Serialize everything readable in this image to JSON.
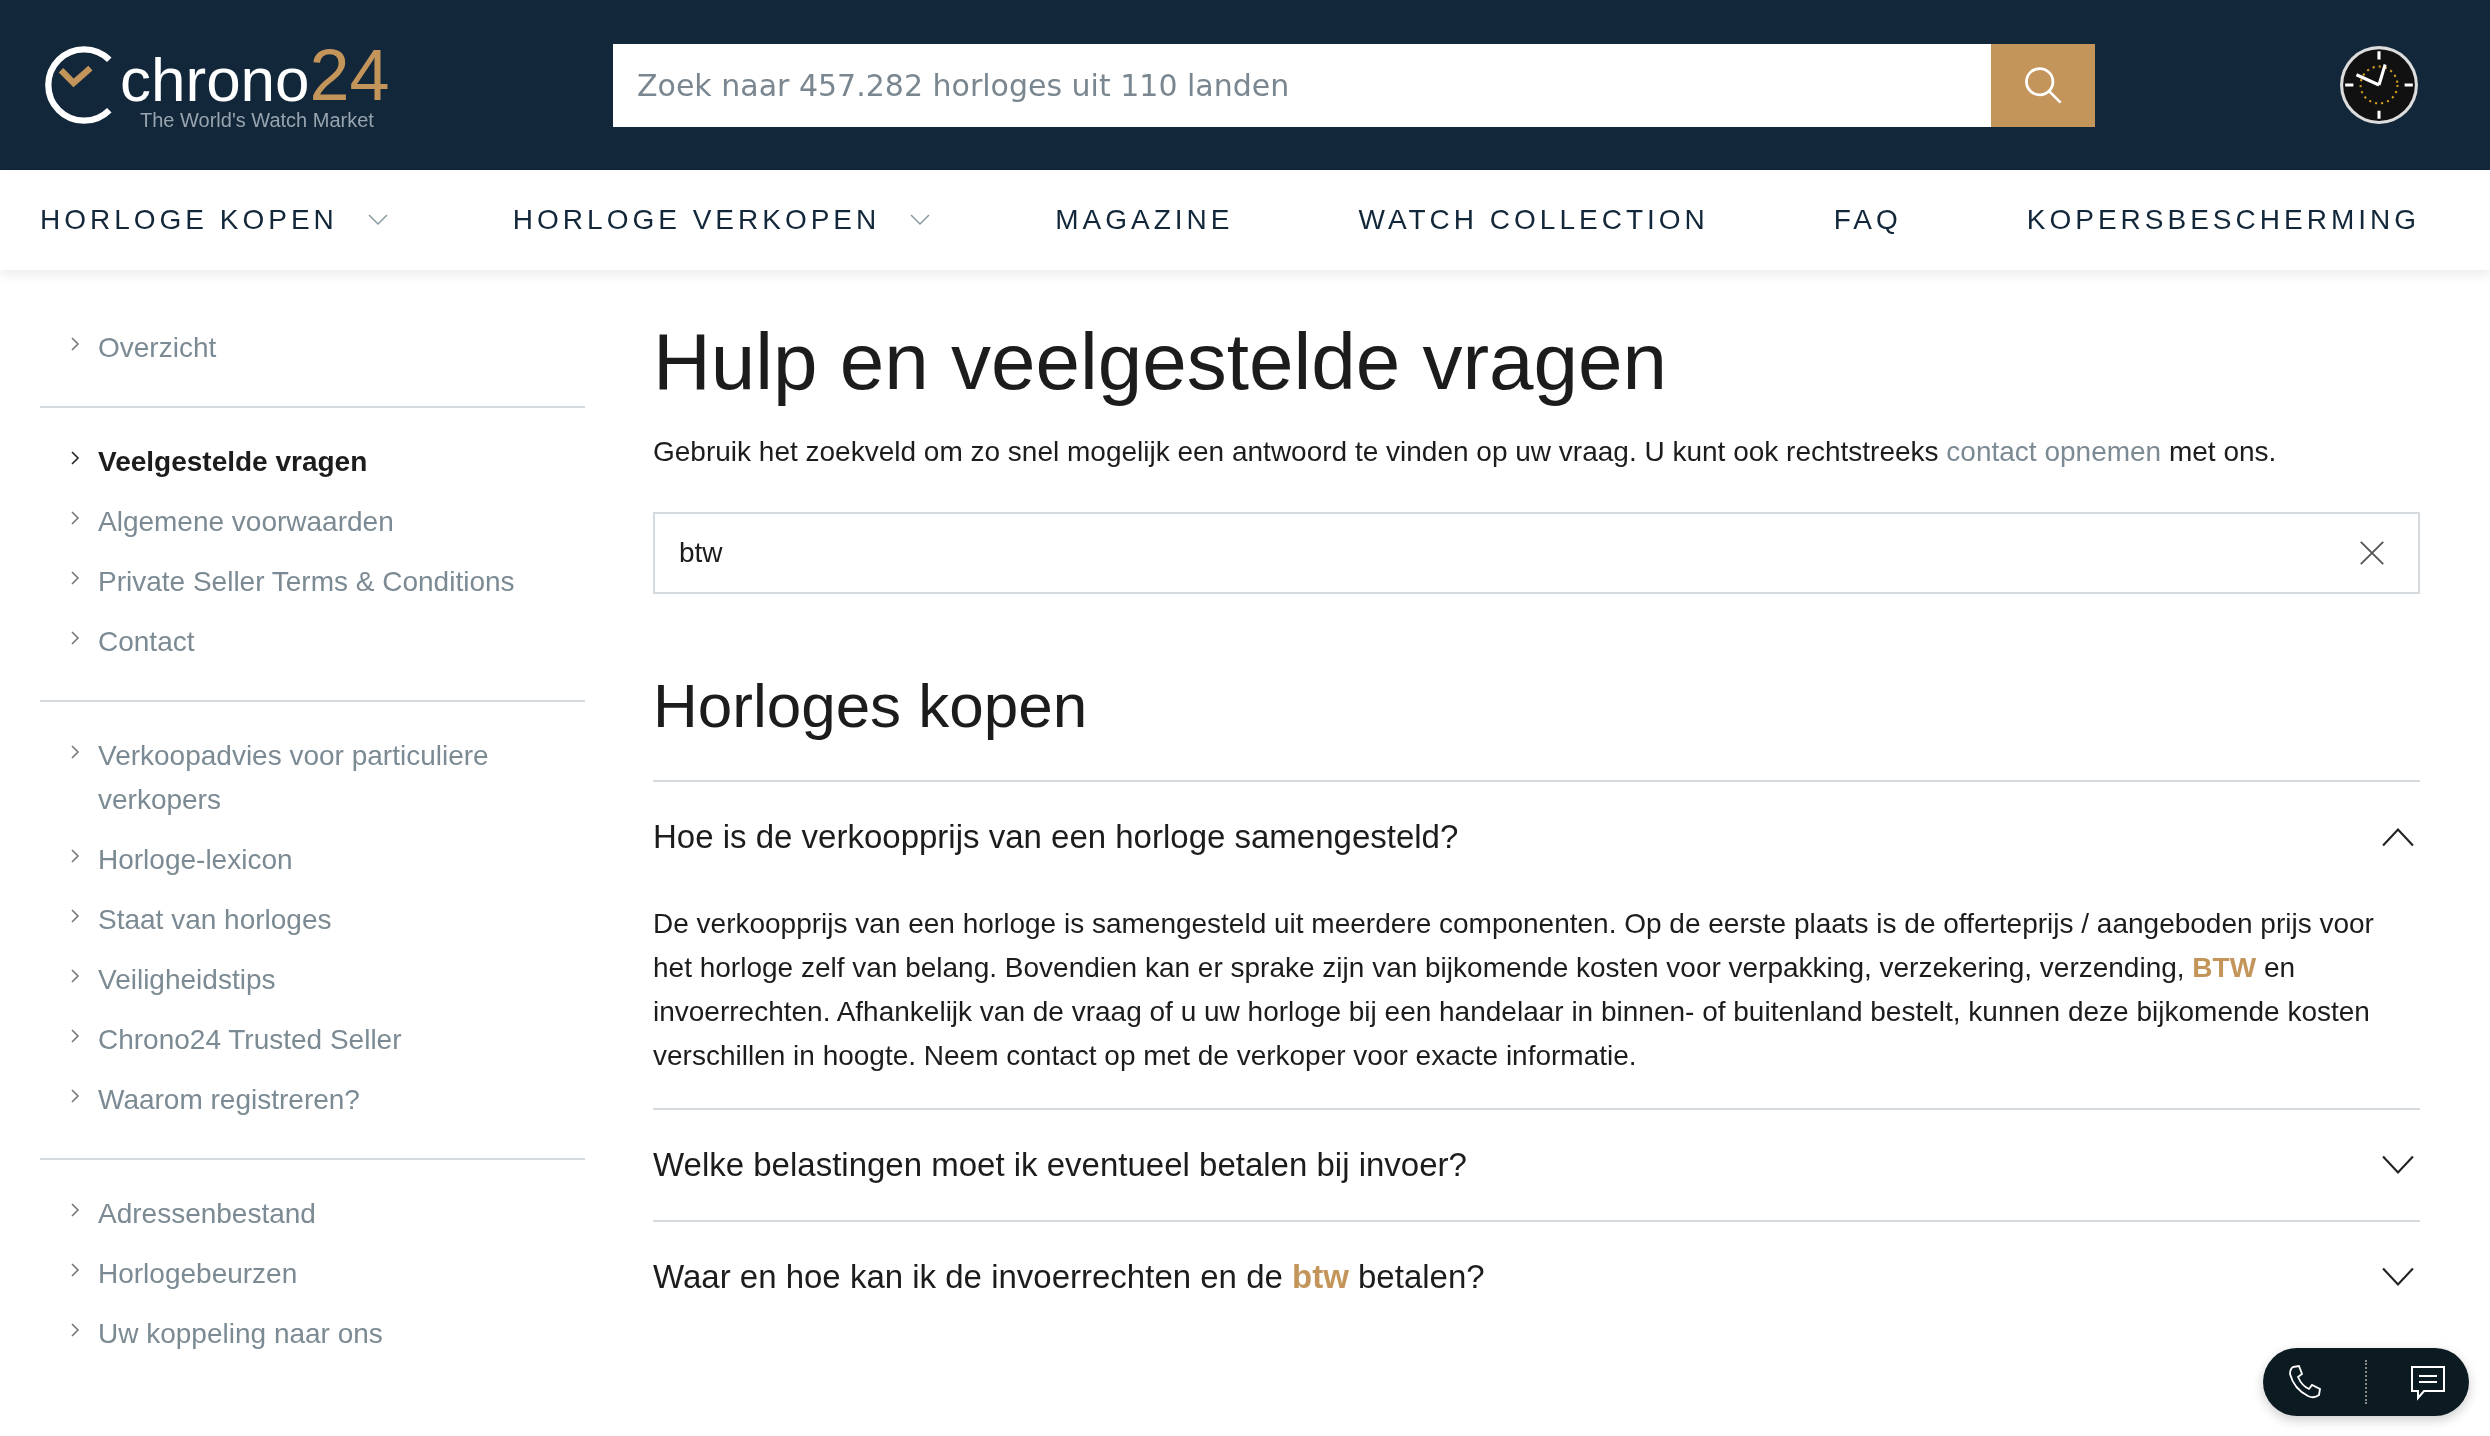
{
  "header": {
    "logo": {
      "word": "chrono",
      "number": "24",
      "tagline": "The World's Watch Market"
    },
    "search": {
      "placeholder": "Zoek naar 457.282 horloges uit 110 landen"
    }
  },
  "nav": [
    {
      "label": "HORLOGE KOPEN",
      "has_dropdown": true
    },
    {
      "label": "HORLOGE VERKOPEN",
      "has_dropdown": true
    },
    {
      "label": "MAGAZINE",
      "has_dropdown": false
    },
    {
      "label": "WATCH COLLECTION",
      "has_dropdown": false
    },
    {
      "label": "FAQ",
      "has_dropdown": false
    },
    {
      "label": "KOPERSBESCHERMING",
      "has_dropdown": false
    }
  ],
  "sidebar": {
    "groups": [
      [
        {
          "label": "Overzicht",
          "selected": false
        }
      ],
      [
        {
          "label": "Veelgestelde vragen",
          "selected": true
        },
        {
          "label": "Algemene voorwaarden",
          "selected": false
        },
        {
          "label": "Private Seller Terms & Conditions",
          "selected": false
        },
        {
          "label": "Contact",
          "selected": false
        }
      ],
      [
        {
          "label": "Verkoopadvies voor particuliere verkopers",
          "selected": false
        },
        {
          "label": "Horloge-lexicon",
          "selected": false
        },
        {
          "label": "Staat van horloges",
          "selected": false
        },
        {
          "label": "Veiligheidstips",
          "selected": false
        },
        {
          "label": "Chrono24 Trusted Seller",
          "selected": false
        },
        {
          "label": "Waarom registreren?",
          "selected": false
        }
      ],
      [
        {
          "label": "Adressenbestand",
          "selected": false
        },
        {
          "label": "Horlogebeurzen",
          "selected": false
        },
        {
          "label": "Uw koppeling naar ons",
          "selected": false
        }
      ]
    ]
  },
  "main": {
    "title": "Hulp en veelgestelde vragen",
    "intro": {
      "before": "Gebruik het zoekveld om zo snel mogelijk een antwoord te vinden op uw vraag. U kunt ook rechtstreeks ",
      "link": "contact opnemen",
      "after": " met ons."
    },
    "faq_search": {
      "value": "btw"
    },
    "section": "Horloges kopen",
    "questions": [
      {
        "question": "Hoe is de verkoopprijs van een horloge samengesteld?",
        "expanded": true,
        "answer": "De verkoopprijs van een horloge is samengesteld uit meerdere componenten. Op de eerste plaats is de offerteprijs / aangeboden prijs voor het horloge zelf van belang. Bovendien kan er sprake zijn van bijkomende kosten voor verpakking, verzekering, verzending, **BTW** en invoerrechten. Afhankelijk van de vraag of u uw horloge bij een handelaar in binnen- of buitenland bestelt, kunnen deze bijkomende kosten verschillen in hoogte. Neem contact op met de verkoper voor exacte informatie."
      },
      {
        "question": "Welke belastingen moet ik eventueel betalen bij invoer?",
        "expanded": false
      },
      {
        "question": "Waar en hoe kan ik de invoerrechten en de **btw** betalen?",
        "expanded": false
      }
    ]
  }
}
